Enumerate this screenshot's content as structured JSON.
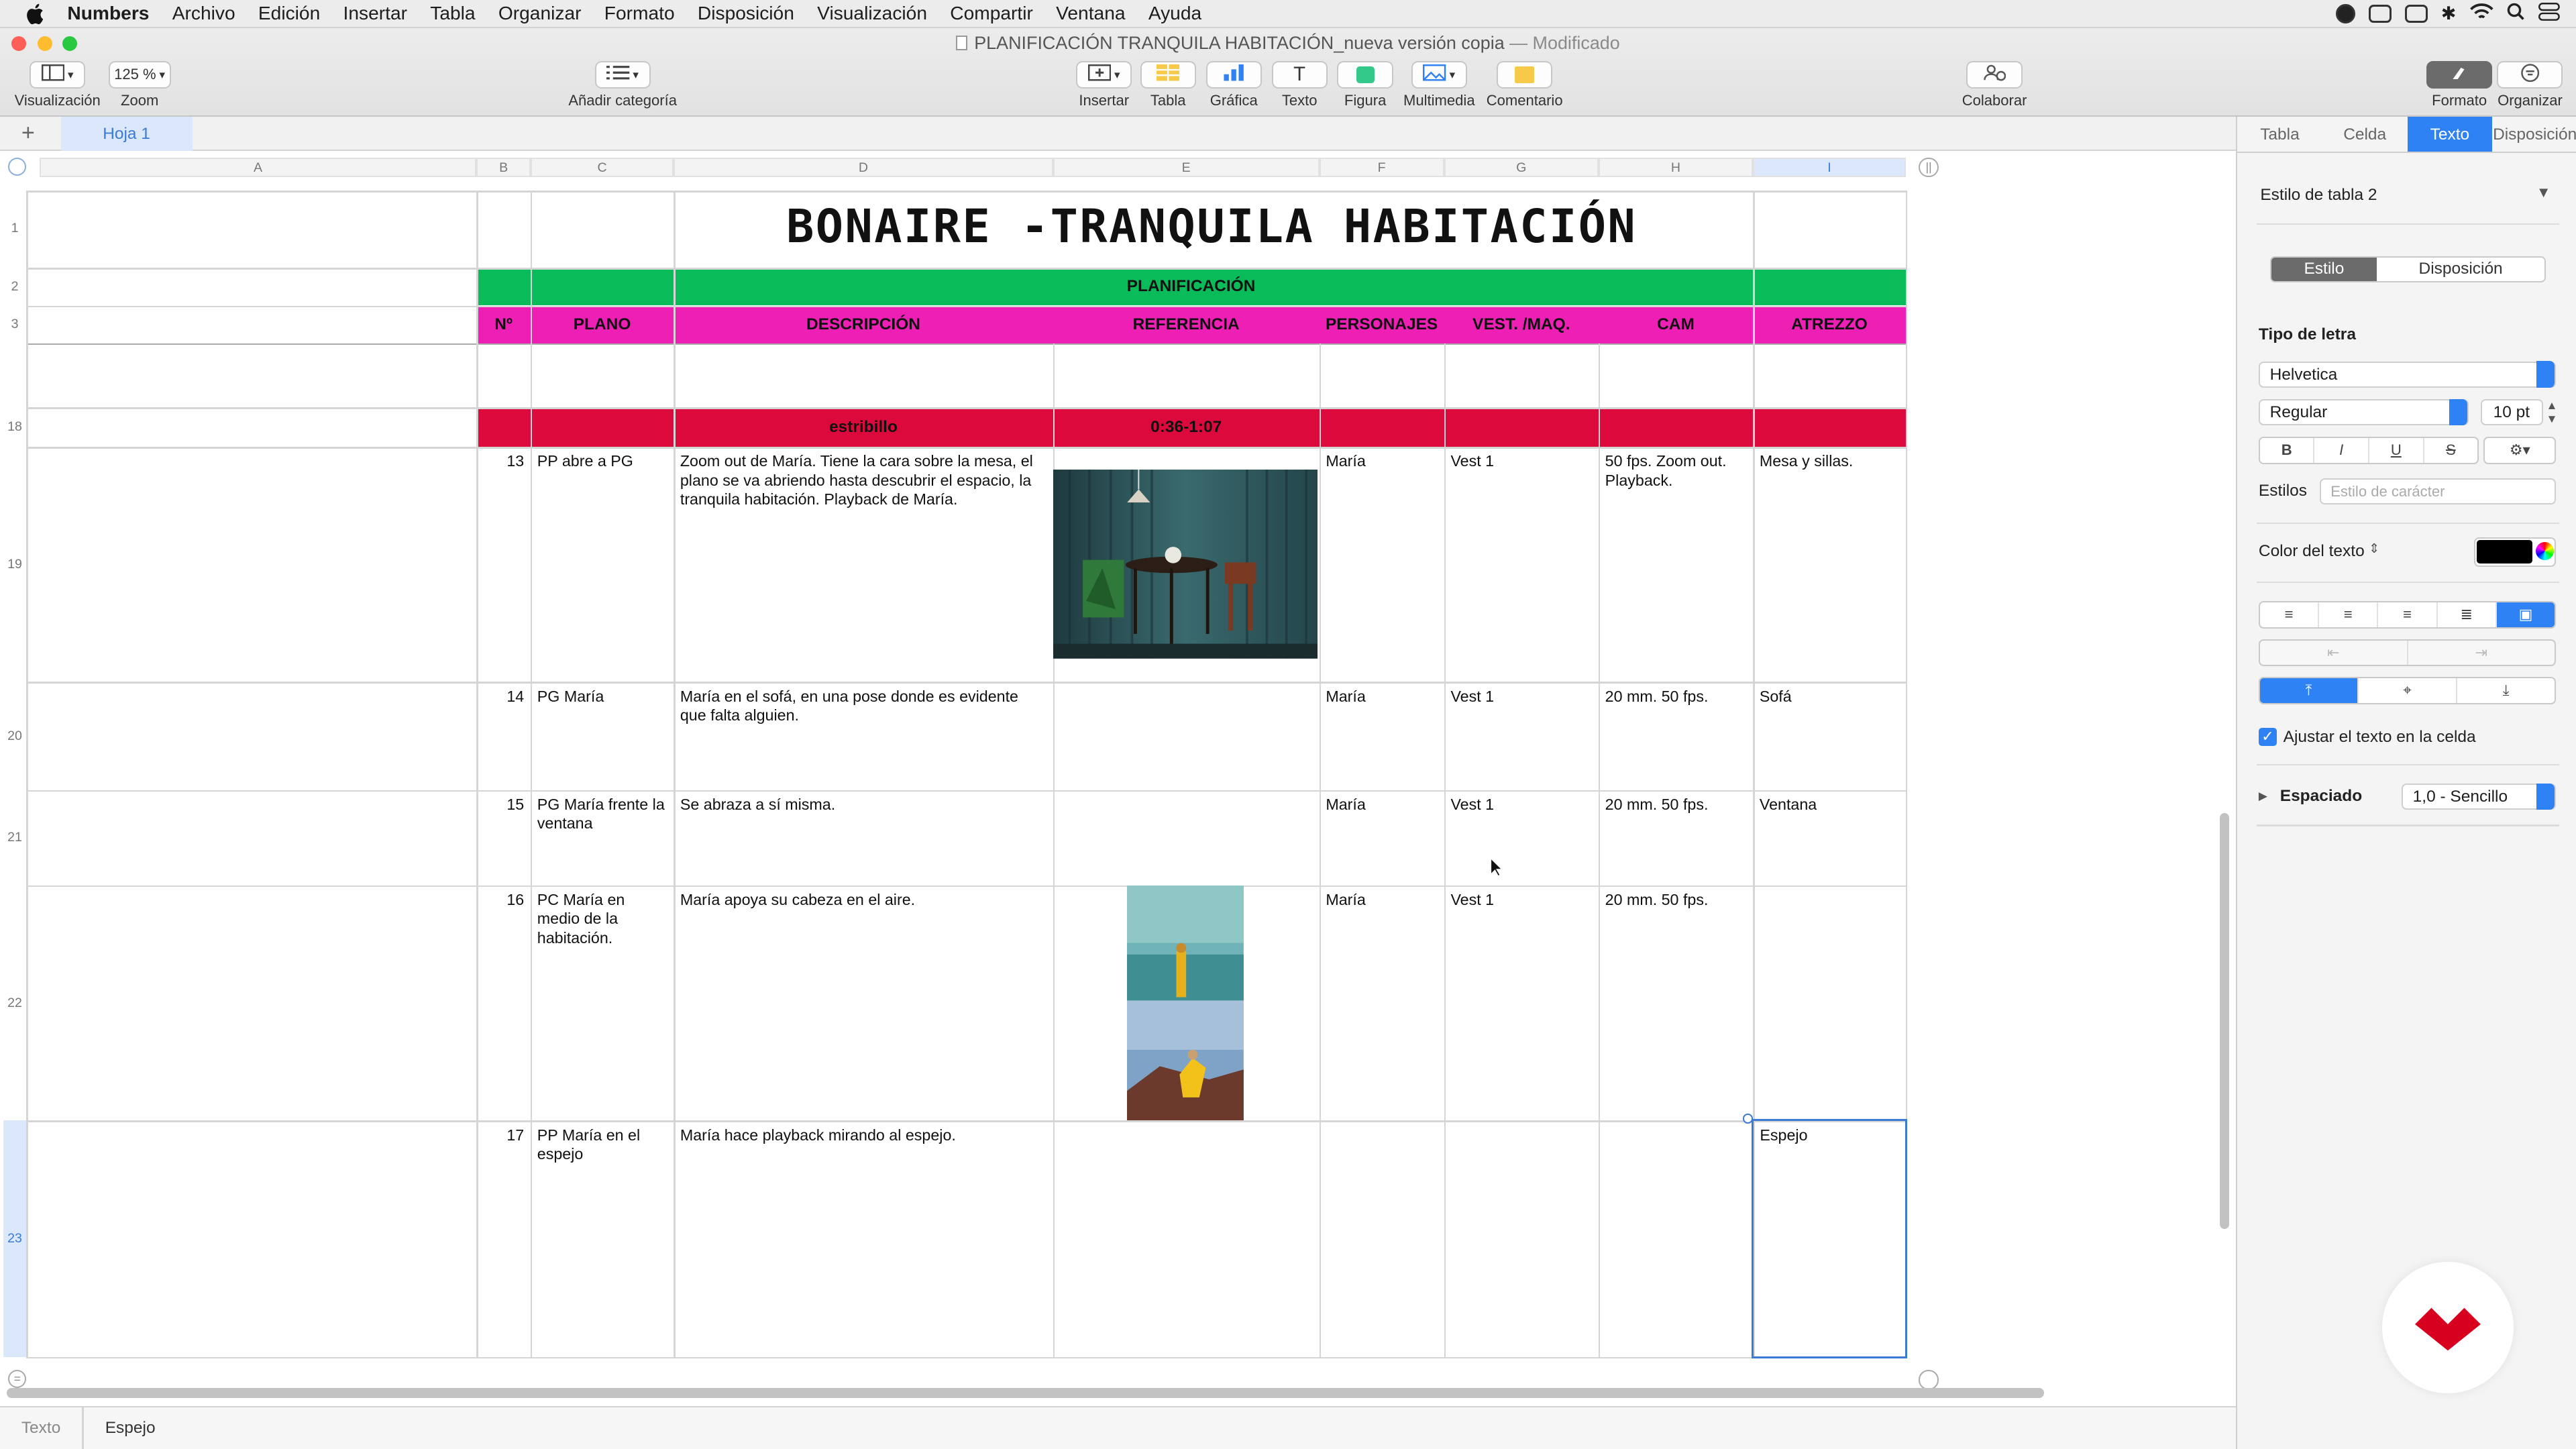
{
  "menubar": {
    "app": "Numbers",
    "items": [
      "Archivo",
      "Edición",
      "Insertar",
      "Tabla",
      "Organizar",
      "Formato",
      "Disposición",
      "Visualización",
      "Compartir",
      "Ventana",
      "Ayuda"
    ]
  },
  "window": {
    "title": "PLANIFICACIÓN TRANQUILA HABITACIÓN_nueva versión copia",
    "modified": "— Modificado"
  },
  "toolbar": {
    "view_label": "Visualización",
    "zoom_value": "125 %",
    "zoom_label": "Zoom",
    "category_label": "Añadir categoría",
    "insert_label": "Insertar",
    "table_label": "Tabla",
    "chart_label": "Gráfica",
    "text_label": "Texto",
    "shape_label": "Figura",
    "media_label": "Multimedia",
    "comment_label": "Comentario",
    "collaborate_label": "Colaborar",
    "format_label": "Formato",
    "organize_label": "Organizar",
    "text_icon": "T"
  },
  "sheets": {
    "add": "+",
    "tab1": "Hoja 1"
  },
  "columns": [
    "A",
    "B",
    "C",
    "D",
    "E",
    "F",
    "G",
    "H",
    "I"
  ],
  "rows": [
    "1",
    "2",
    "3",
    "18",
    "19",
    "20",
    "21",
    "22",
    "23"
  ],
  "sheet": {
    "title": "BONAIRE -TRANQUILA HABITACIÓN",
    "planning_label": "PLANIFICACIÓN",
    "headers": {
      "n": "Nº",
      "plano": "PLANO",
      "descripcion": "DESCRIPCIÓN",
      "referencia": "REFERENCIA",
      "personajes": "PERSONAJES",
      "vest": "VEST. /MAQ.",
      "cam": "CAM",
      "atrezzo": "ATREZZO"
    },
    "section": {
      "name": "estribillo",
      "time": "0:36-1:07"
    },
    "rows": [
      {
        "n": "13",
        "plano": "PP abre a PG",
        "descripcion": "Zoom out de María. Tiene la cara sobre la mesa, el plano se va abriendo hasta descubrir el espacio, la tranquila habitación. Playback de María.",
        "personajes": "María",
        "vest": "Vest 1",
        "cam": "50 fps. Zoom out. Playback.",
        "atrezzo": "Mesa y sillas."
      },
      {
        "n": "14",
        "plano": "PG María",
        "descripcion": "María en el sofá, en una pose donde es evidente que falta alguien.",
        "personajes": "María",
        "vest": "Vest 1",
        "cam": "20 mm. 50 fps.",
        "atrezzo": "Sofá"
      },
      {
        "n": "15",
        "plano": "PG María frente la ventana",
        "descripcion": "Se abraza a sí misma.",
        "personajes": "María",
        "vest": "Vest 1",
        "cam": "20 mm. 50 fps.",
        "atrezzo": "Ventana"
      },
      {
        "n": "16",
        "plano": "PC María en medio de la habitación.",
        "descripcion": "María apoya su cabeza en el aire.",
        "personajes": "María",
        "vest": "Vest 1",
        "cam": "20 mm. 50 fps.",
        "atrezzo": ""
      },
      {
        "n": "17",
        "plano": "PP María en el espejo",
        "descripcion": "María hace playback mirando al espejo.",
        "personajes": "",
        "vest": "",
        "cam": "",
        "atrezzo": "Espejo"
      }
    ],
    "colors": {
      "green": "#0abb5a",
      "magenta": "#ee1fb5",
      "red": "#dc0a3c",
      "selection": "#3a7bd5"
    }
  },
  "inspector": {
    "tabs": [
      "Tabla",
      "Celda",
      "Texto",
      "Disposición"
    ],
    "active_tab": "Texto",
    "table_style": "Estilo de tabla 2",
    "seg_style": "Estilo",
    "seg_layout": "Disposición",
    "font_section": "Tipo de letra",
    "font": "Helvetica",
    "weight": "Regular",
    "size": "10 pt",
    "bold": "B",
    "italic": "I",
    "underline": "U",
    "strike": "S",
    "styles_label": "Estilos",
    "char_style": "Estilo de carácter",
    "text_color_label": "Color del texto",
    "text_color": "#000000",
    "wrap_label": "Ajustar el texto en la celda",
    "spacing_label": "Espaciado",
    "spacing_value": "1,0 - Sencillo"
  },
  "bottom": {
    "left": "Texto",
    "right": "Espejo"
  }
}
